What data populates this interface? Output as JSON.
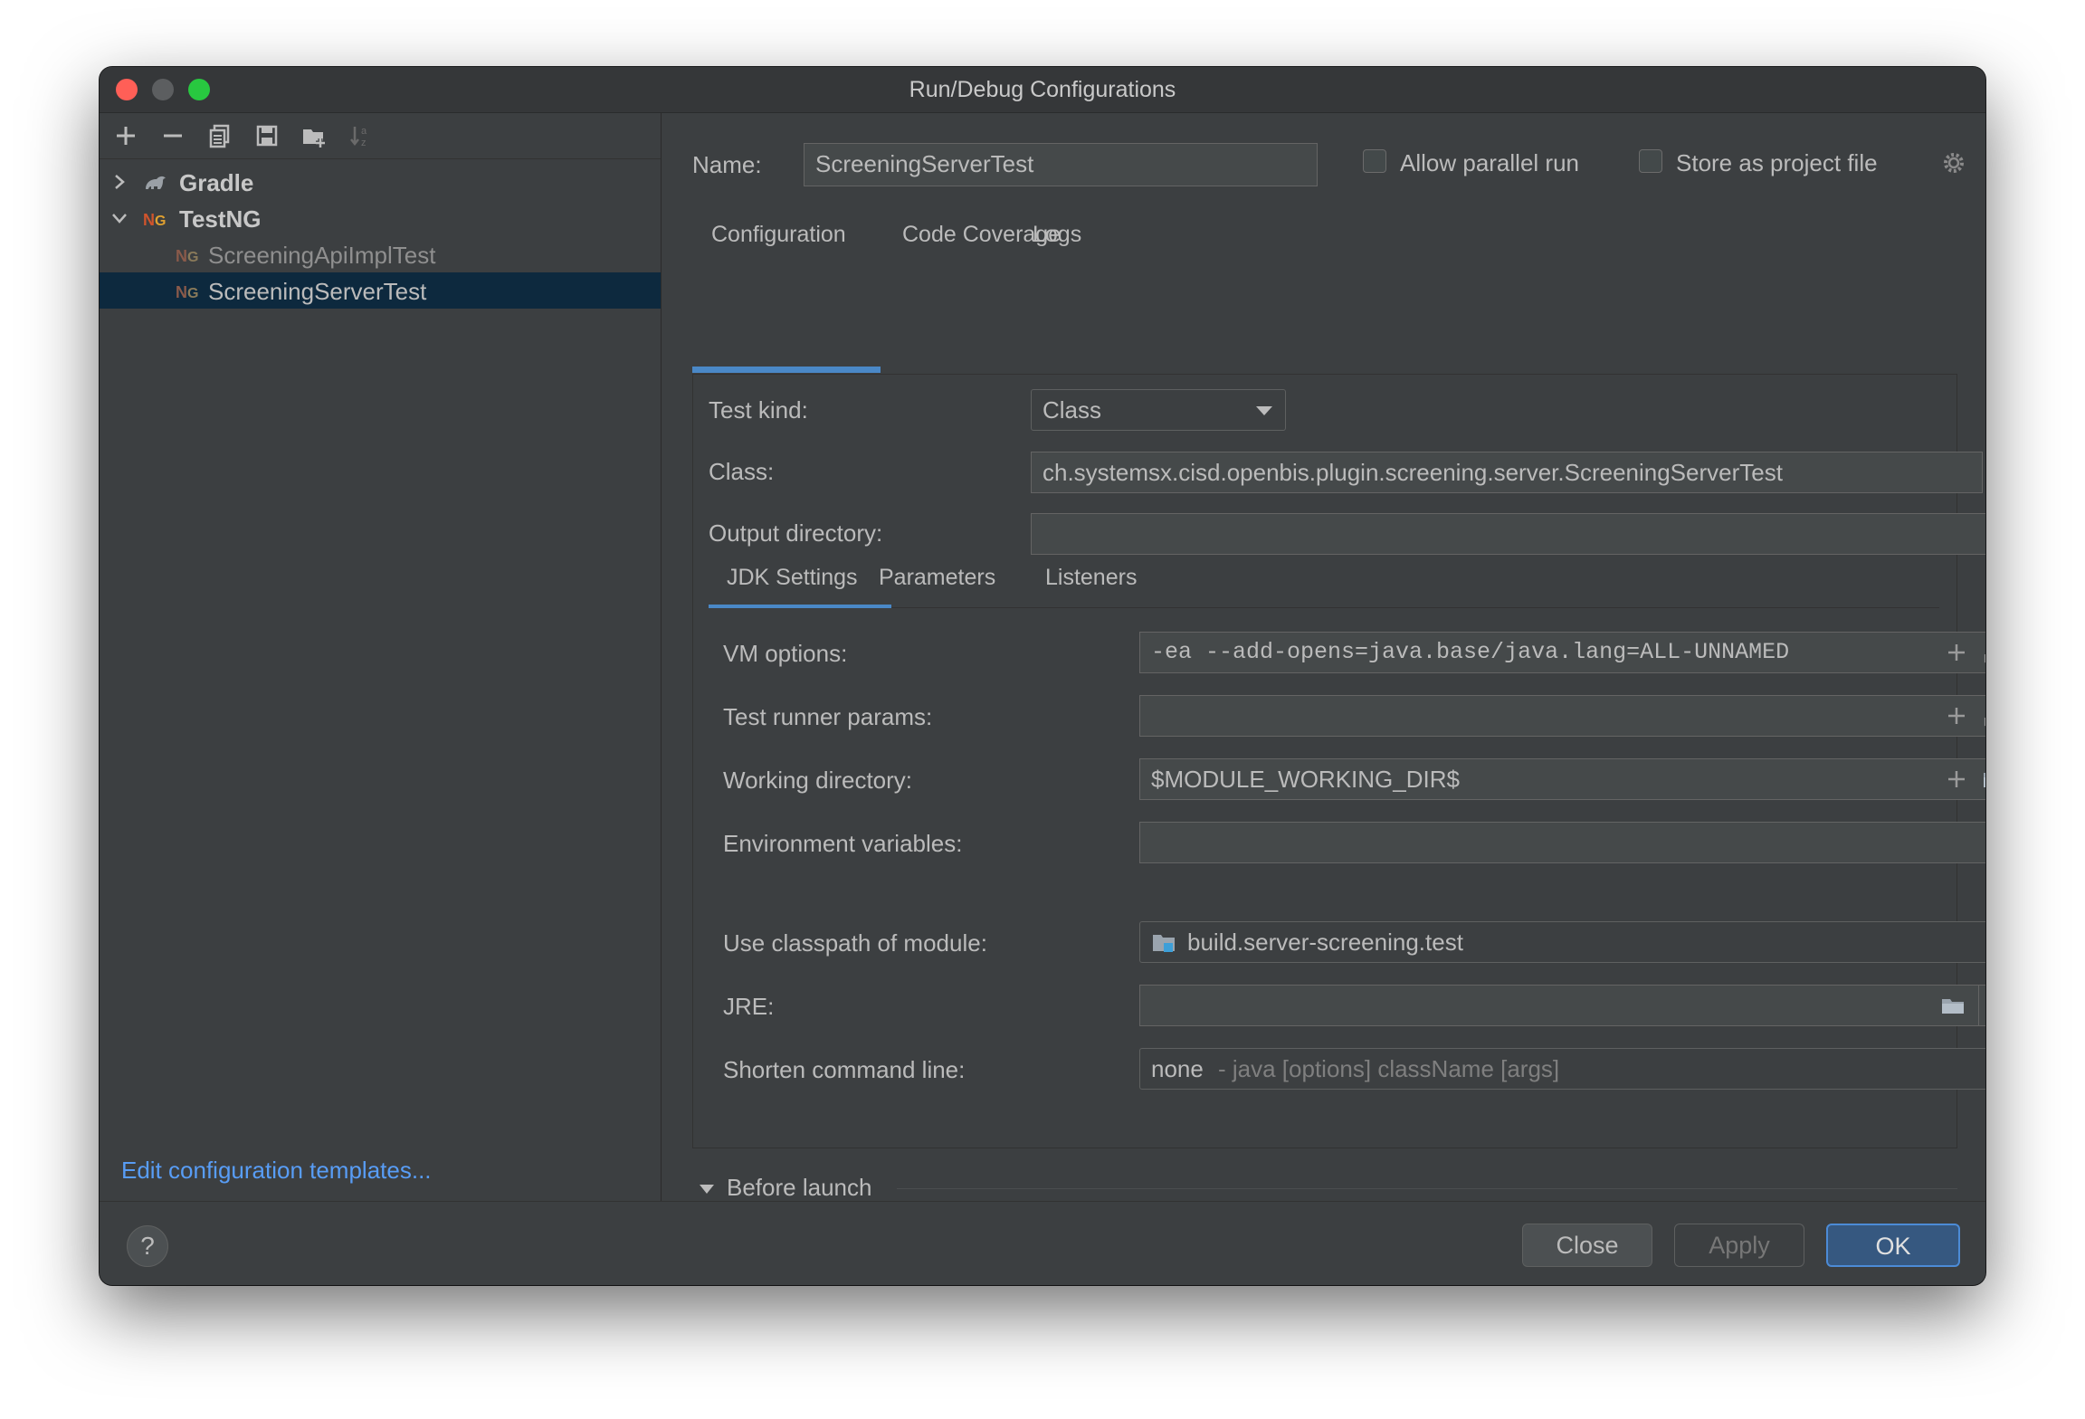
{
  "window": {
    "title": "Run/Debug Configurations"
  },
  "sidebar": {
    "tree": [
      {
        "label": "Gradle",
        "icon": "gradle-icon",
        "expanded": false
      },
      {
        "label": "TestNG",
        "icon": "testng-icon",
        "expanded": true
      },
      {
        "label": "ScreeningApiImplTest",
        "icon": "testng-icon"
      },
      {
        "label": "ScreeningServerTest",
        "icon": "testng-icon",
        "selected": true
      }
    ],
    "edit_templates_link": "Edit configuration templates..."
  },
  "header": {
    "name_label": "Name:",
    "name_value": "ScreeningServerTest",
    "allow_parallel_label": "Allow parallel run",
    "allow_parallel_checked": false,
    "store_project_label": "Store as project file",
    "store_project_checked": false
  },
  "main_tabs": [
    {
      "label": "Configuration",
      "active": true
    },
    {
      "label": "Code Coverage"
    },
    {
      "label": "Logs"
    }
  ],
  "config": {
    "test_kind_label": "Test kind:",
    "test_kind_value": "Class",
    "class_label": "Class:",
    "class_value": "ch.systemsx.cisd.openbis.plugin.screening.server.ScreeningServerTest",
    "browse_label": "...",
    "output_dir_label": "Output directory:",
    "output_dir_value": ""
  },
  "sub_tabs": [
    {
      "label": "JDK Settings",
      "active": true
    },
    {
      "label": "Parameters"
    },
    {
      "label": "Listeners"
    }
  ],
  "jdk": {
    "vm_options_label": "VM options:",
    "vm_options_value": "-ea --add-opens=java.base/java.lang=ALL-UNNAMED",
    "runner_params_label": "Test runner params:",
    "runner_params_value": "",
    "working_dir_label": "Working directory:",
    "working_dir_value": "$MODULE_WORKING_DIR$",
    "env_vars_label": "Environment variables:",
    "env_vars_value": "",
    "classpath_label": "Use classpath of module:",
    "classpath_value": "build.server-screening.test",
    "jre_label": "JRE:",
    "jre_value": "",
    "shorten_label": "Shorten command line:",
    "shorten_value": "none",
    "shorten_hint": "- java [options] className [args]"
  },
  "before_launch": {
    "label": "Before launch"
  },
  "buttons": {
    "close": "Close",
    "apply": "Apply",
    "ok": "OK",
    "help": "?"
  },
  "colors": {
    "accent": "#4a88c7",
    "selection": "#0d293e",
    "link": "#589df6",
    "background": "#3c3f41"
  }
}
